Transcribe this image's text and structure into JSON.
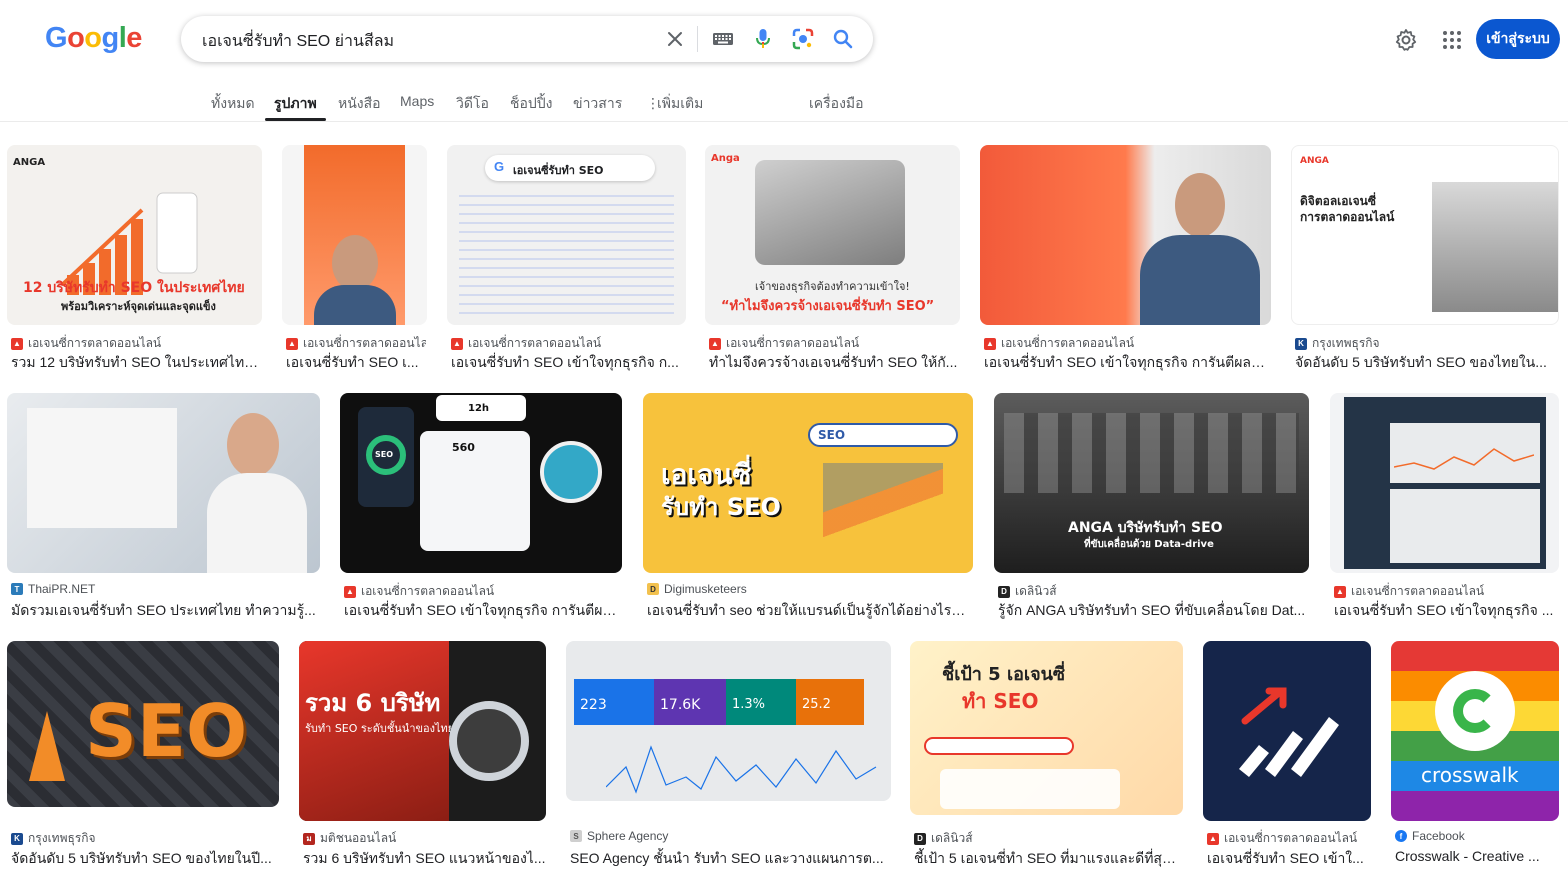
{
  "header": {
    "logo": "Google",
    "query": "เอเจนซี่รับทำ SEO ย่านสีลม",
    "signin_label": "เข้าสู่ระบบ",
    "icons": [
      "clear-icon",
      "keyboard-icon",
      "mic-icon",
      "lens-icon",
      "search-icon",
      "settings-icon",
      "apps-icon"
    ]
  },
  "tabs": [
    {
      "label": "ทั้งหมด"
    },
    {
      "label": "รูปภาพ"
    },
    {
      "label": "หนังสือ"
    },
    {
      "label": "Maps"
    },
    {
      "label": "วิดีโอ"
    },
    {
      "label": "ช็อปปิ้ง"
    },
    {
      "label": "ข่าวสาร"
    },
    {
      "label": "เพิ่มเติม"
    },
    {
      "label": "เครื่องมือ"
    }
  ],
  "colors": {
    "accent": "#0b57d0",
    "anga_red": "#e8372b",
    "orange": "#f26b2b"
  },
  "results": [
    {
      "source": "เอเจนซี่การตลาดออนไลน์",
      "title": "รวม 12 บริษัทรับทำ SEO ในประเทศไทย...",
      "overlay": "12 บริษัทรับทำ SEO ในประเทศไทย",
      "overlay2": "พร้อมวิเคราะห์จุดเด่นและจุดแข็ง",
      "brand": "ANGA"
    },
    {
      "source": "เอเจนซี่การตลาดออนไลน์",
      "title": "เอเจนซี่รับทำ SEO เ..."
    },
    {
      "source": "เอเจนซี่การตลาดออนไลน์",
      "title": "เอเจนซี่รับทำ SEO เข้าใจทุกธุรกิจ ก...",
      "overlay": "เอเจนซี่รับทำ SEO"
    },
    {
      "source": "เอเจนซี่การตลาดออนไลน์",
      "title": "ทำไมจึงควรจ้างเอเจนซี่รับทำ SEO ให้กั...",
      "overlay": "เจ้าของธุรกิจต้องทำความเข้าใจ!",
      "overlay2": "“ทำไมจึงควรจ้างเอเจนซี่รับทำ SEO”",
      "brand": "Anga"
    },
    {
      "source": "เอเจนซี่การตลาดออนไลน์",
      "title": "เอเจนซี่รับทำ SEO เข้าใจทุกธุรกิจ การันตีผลลั..."
    },
    {
      "source": "กรุงเทพธุรกิจ",
      "title": "จัดอันดับ 5 บริษัทรับทำ SEO ของไทยใน...",
      "overlay": "ดิจิตอลเอเจนซี่",
      "overlay2": "การตลาดออนไลน์",
      "brand": "ANGA"
    },
    {
      "source": "ThaiPR.NET",
      "title": "มัดรวมเอเจนซี่รับทำ SEO ประเทศไทย ทำความรู้..."
    },
    {
      "source": "เอเจนซี่การตลาดออนไลน์",
      "title": "เอเจนซี่รับทำ SEO เข้าใจทุกธุรกิจ การันตีผล...",
      "overlay": "560",
      "overlay2": "12h",
      "brand": "SEO"
    },
    {
      "source": "Digimusketeers",
      "title": "เอเจนซี่รับทำ seo ช่วยให้แบรนด์เป็นรู้จักได้อย่างไร? ...",
      "overlay": "เอเจนซี่",
      "overlay2": "รับทำ SEO",
      "brand": "SEO"
    },
    {
      "source": "เดลินิวส์",
      "title": "รู้จัก ANGA บริษัทรับทำ SEO ที่ขับเคลื่อนโดย Dat...",
      "overlay": "ANGA บริษัทรับทำ SEO",
      "overlay2": "ที่ขับเคลื่อนด้วย Data-drive"
    },
    {
      "source": "เอเจนซี่การตลาดออนไลน์",
      "title": "เอเจนซี่รับทำ SEO เข้าใจทุกธุรกิจ ..."
    },
    {
      "source": "กรุงเทพธุรกิจ",
      "title": "จัดอันดับ 5 บริษัทรับทำ SEO ของไทยในปี...",
      "overlay": "SEO"
    },
    {
      "source": "มติชนออนไลน์",
      "title": "รวม 6 บริษัทรับทำ SEO แนวหน้าของไ...",
      "overlay": "รวม 6 บริษัท",
      "overlay2": "รับทำ SEO ระดับชั้นนำของไทย"
    },
    {
      "source": "Sphere Agency",
      "title": "SEO Agency ชั้นนำ รับทำ SEO และวางแผนการต...",
      "overlay": "223",
      "overlay2": "17.6K",
      "brand": "1.3%",
      "extra": "25.2"
    },
    {
      "source": "เดลินิวส์",
      "title": "ชี้เป้า 5 เอเจนซี่ทำ SEO ที่มาแรงและดีที่สุด...",
      "overlay": "ชี้เป้า 5 เอเจนซี่",
      "overlay2": "ทำ SEO"
    },
    {
      "source": "เอเจนซี่การตลาดออนไลน์",
      "title": "เอเจนซี่รับทำ SEO เข้าใ..."
    },
    {
      "source": "Facebook",
      "title": "Crosswalk - Creative ...",
      "overlay": "crosswalk"
    }
  ]
}
